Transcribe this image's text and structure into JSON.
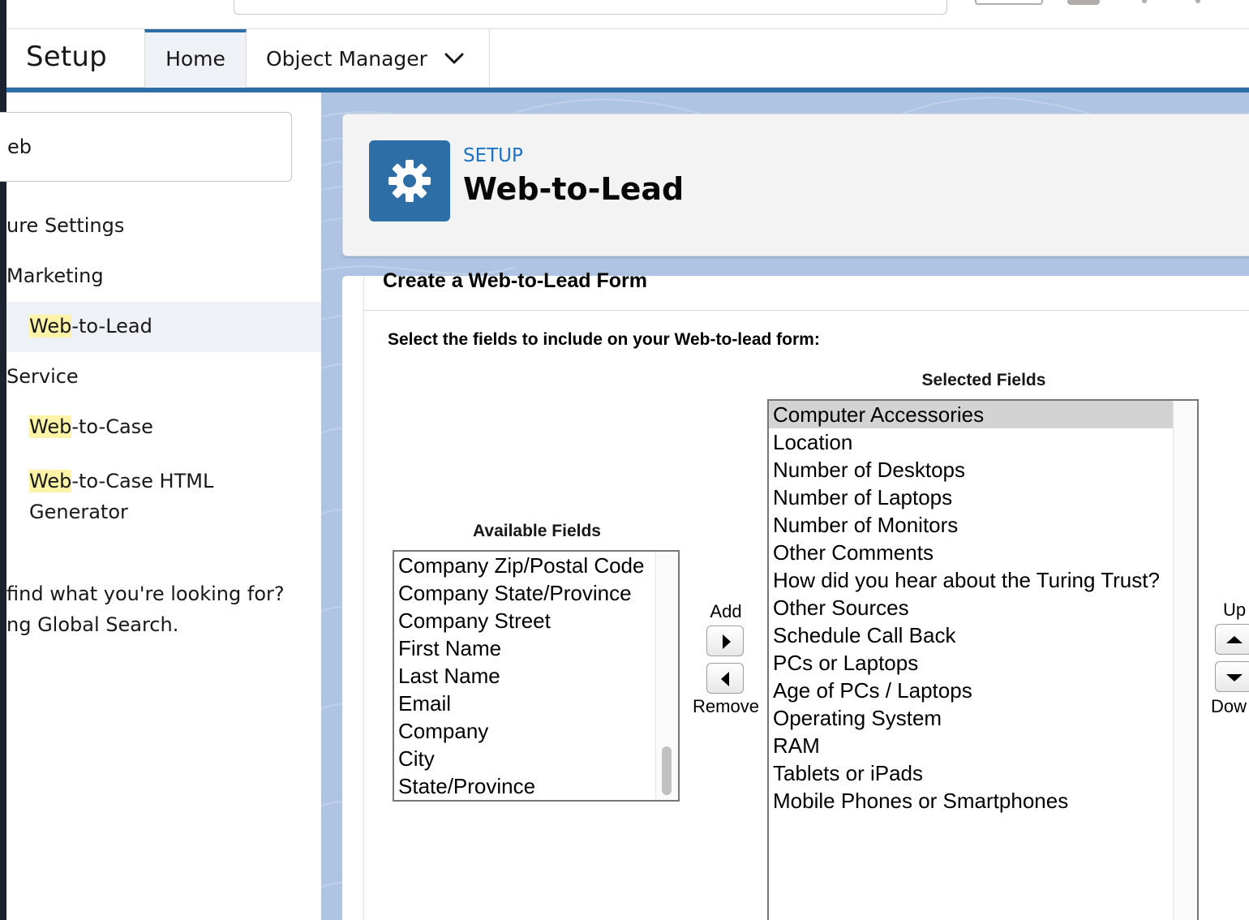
{
  "nav": {
    "app_name": "Setup",
    "tabs": [
      {
        "label": "Home"
      },
      {
        "label": "Object Manager"
      }
    ]
  },
  "sidebar": {
    "search_value": "eb",
    "items": [
      {
        "label": "ure Settings"
      },
      {
        "label": "Marketing"
      },
      {
        "highlight": "Web",
        "rest": "-to-Lead"
      },
      {
        "label": "Service"
      },
      {
        "highlight": "Web",
        "rest": "-to-Case"
      },
      {
        "highlight": "Web",
        "rest": "-to-Case HTML",
        "line2": "Generator"
      }
    ],
    "help_line1": "find what you're looking for?",
    "help_line2": "ng Global Search."
  },
  "header": {
    "eyebrow": "SETUP",
    "title": "Web-to-Lead"
  },
  "form": {
    "section_title": "Create a Web-to-Lead Form",
    "instructions": "Select the fields to include on your Web-to-lead form:",
    "available_label": "Available Fields",
    "selected_label": "Selected Fields",
    "available_fields": [
      "Company Zip/Postal Code",
      "Company State/Province",
      "Company Street",
      "First Name",
      "Last Name",
      "Email",
      "Company",
      "City",
      "State/Province"
    ],
    "selected_fields": [
      "Computer Accessories",
      "Location",
      "Number of Desktops",
      "Number of Laptops",
      "Number of Monitors",
      "Other Comments",
      "How did you hear about the Turing Trust?",
      "Other Sources",
      "Schedule Call Back",
      "PCs or Laptops",
      "Age of PCs / Laptops",
      "Operating System",
      "RAM",
      "Tablets or iPads",
      "Mobile Phones or Smartphones"
    ],
    "add_label": "Add",
    "remove_label": "Remove",
    "up_label": "Up",
    "down_label": "Dow"
  },
  "colors": {
    "brand_blue": "#2e6ea6",
    "link_blue": "#1b72c2",
    "search_highlight": "#fff3a8",
    "page_bg": "#afc4e2"
  }
}
